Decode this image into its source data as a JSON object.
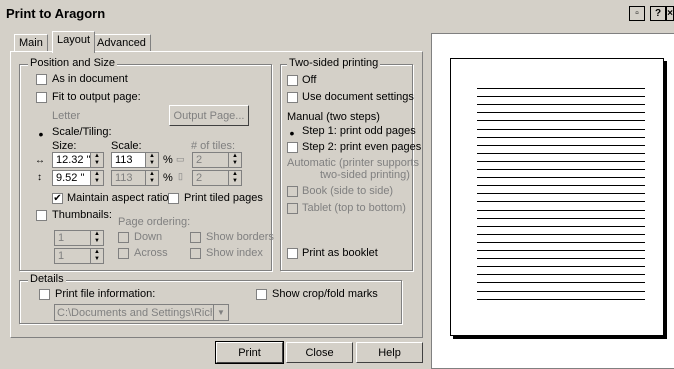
{
  "title": "Print to Aragorn",
  "title_buttons": [
    "▫",
    "?",
    "×"
  ],
  "tabs": [
    "Main",
    "Layout",
    "Advanced"
  ],
  "position_size": {
    "group_label": "Position and Size",
    "as_in_document": "As in document",
    "fit_to_page": "Fit to output page:",
    "letter": "Letter",
    "output_page_button": "Output Page...",
    "scale_tiling": "Scale/Tiling:",
    "size_label": "Size:",
    "scale_label": "Scale:",
    "tiles_label": "# of tiles:",
    "width_value": "12.32 \"",
    "height_value": "9.52 \"",
    "scale_x": "113",
    "scale_y": "113",
    "pct": "%",
    "tiles_x": "2",
    "tiles_y": "2",
    "maintain_aspect": "Maintain aspect ratio",
    "print_tiled": "Print tiled pages",
    "thumbnails": "Thumbnails:",
    "page_ordering": "Page ordering:",
    "down": "Down",
    "across": "Across",
    "show_borders": "Show borders",
    "show_index": "Show index",
    "thumb_1": "1",
    "thumb_2": "1"
  },
  "two_sided": {
    "group_label": "Two-sided printing",
    "off": "Off",
    "use_doc": "Use document settings",
    "manual": "Manual (two steps)",
    "step1": "Step 1: print odd pages",
    "step2": "Step 2: print even pages",
    "automatic_1": "Automatic (printer supports",
    "automatic_2": "two-sided printing)",
    "book": "Book (side to side)",
    "tablet": "Tablet (top to bottom)",
    "booklet": "Print as booklet"
  },
  "details": {
    "group_label": "Details",
    "print_file_info": "Print file information:",
    "show_crop": "Show crop/fold marks",
    "path": "C:\\Documents and Settings\\Richard\\"
  },
  "buttons": {
    "print": "Print",
    "close": "Close",
    "help": "Help"
  },
  "preview": {
    "line_count": 27
  }
}
